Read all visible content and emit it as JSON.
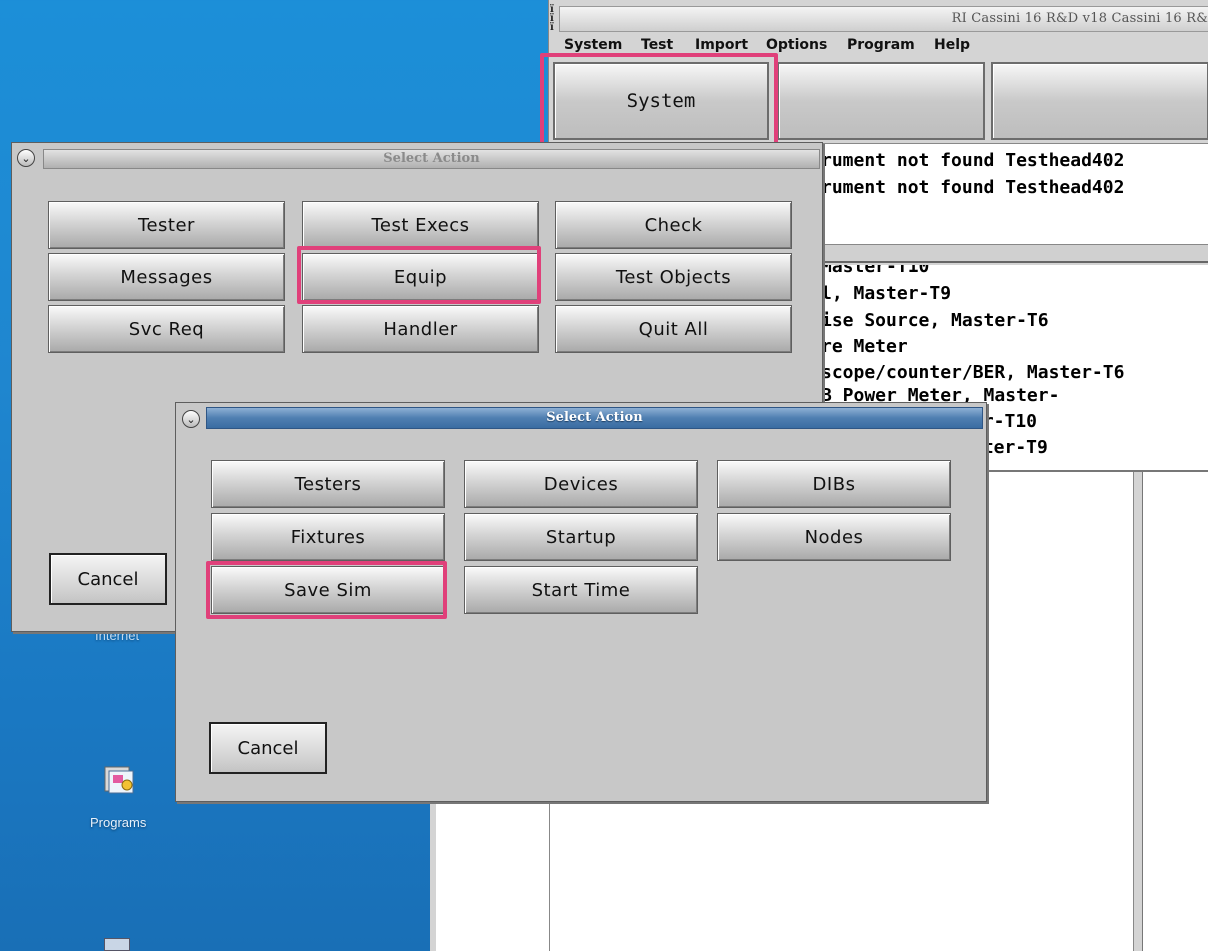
{
  "desktop": {
    "icons": [
      {
        "label": "Internet"
      },
      {
        "label": "Programs"
      }
    ]
  },
  "app": {
    "title": "RI Cassini 16 R&D v18  Cassini 16 R&",
    "menu": [
      "System",
      "Test",
      "Import",
      "Options",
      "Program",
      "Help"
    ],
    "toolbar": [
      "System",
      "",
      ""
    ],
    "messages": [
      "rument not found Testhead402",
      "rument not found Testhead402"
    ],
    "equipment_list": [
      "  Master-T10",
      "l, Master-T9",
      "ise Source, Master-T6",
      "re Meter",
      "scope/counter/BER, Master-T6",
      "B Power Meter, Master-",
      "er-T10",
      "ster-T9"
    ]
  },
  "dialog_back": {
    "title": "Select Action",
    "buttons": [
      "Tester",
      "Test Execs",
      "Check",
      "Messages",
      "Equip",
      "Test Objects",
      "Svc Req",
      "Handler",
      "Quit All"
    ],
    "cancel": "Cancel"
  },
  "dialog_front": {
    "title": "Select Action",
    "buttons": [
      "Testers",
      "Devices",
      "DIBs",
      "Fixtures",
      "Startup",
      "Nodes",
      "Save Sim",
      "Start Time"
    ],
    "cancel": "Cancel"
  },
  "colors": {
    "desktop": "#1c8fd8",
    "highlight": "#e0407a",
    "dialog_titlebar_active": "#4f7fb1"
  }
}
